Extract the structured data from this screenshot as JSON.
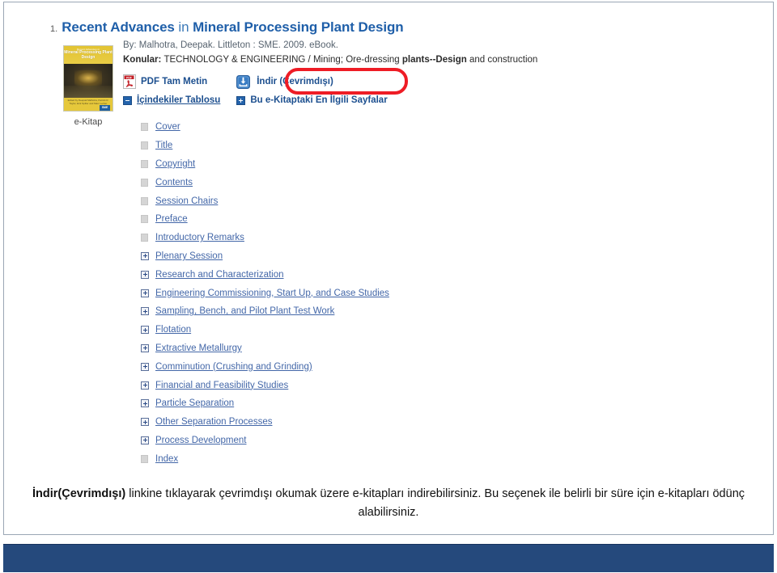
{
  "slide": {
    "footer_color": "#25497c",
    "border_color": "#9aa6b4"
  },
  "result": {
    "number": "1.",
    "title_part1": "Recent Advances",
    "title_connector": "in",
    "title_part2": "Mineral Processing Plant Design",
    "byline": "By: Malhotra, Deepak. Littleton : SME. 2009. eBook.",
    "subjects_label": "Konular:",
    "subjects_text_1": "TECHNOLOGY & ENGINEERING / Mining; Ore-dressing ",
    "subjects_bold": "plants--Design",
    "subjects_text_2": " and construction",
    "cover": {
      "kicker": "Recent Advances in",
      "title": "Mineral Processing Plant Design",
      "authors": "Edited by Deepak Malhotra, Patrick R. Taylor, Erik Spiller and Marc LeVier",
      "badge": "SME",
      "caption": "e-Kitap"
    },
    "actions": {
      "pdf_label": "PDF Tam Metin",
      "download_label": "İndir (Çevrimdışı)",
      "pdf_icon": "pdf-icon",
      "download_icon": "download-icon"
    },
    "toggles": {
      "toc_label": "İçindekiler Tablosu",
      "toc_icon": "minus-box-icon",
      "related_label": "Bu e-Kitaptaki En İlgili Sayfalar",
      "related_icon": "plus-box-icon"
    }
  },
  "toc": {
    "items": [
      {
        "label": "Cover",
        "icon": "leaf-node-icon",
        "expandable": false
      },
      {
        "label": "Title",
        "icon": "leaf-node-icon",
        "expandable": false
      },
      {
        "label": "Copyright",
        "icon": "leaf-node-icon",
        "expandable": false
      },
      {
        "label": "Contents",
        "icon": "leaf-node-icon",
        "expandable": false
      },
      {
        "label": "Session Chairs",
        "icon": "leaf-node-icon",
        "expandable": false
      },
      {
        "label": "Preface",
        "icon": "leaf-node-icon",
        "expandable": false
      },
      {
        "label": "Introductory Remarks",
        "icon": "leaf-node-icon",
        "expandable": false
      },
      {
        "label": "Plenary Session",
        "icon": "plus-box-icon",
        "expandable": true
      },
      {
        "label": "Research and Characterization",
        "icon": "plus-box-icon",
        "expandable": true
      },
      {
        "label": "Engineering Commissioning, Start Up, and Case Studies",
        "icon": "plus-box-icon",
        "expandable": true
      },
      {
        "label": "Sampling, Bench, and Pilot Plant Test Work",
        "icon": "plus-box-icon",
        "expandable": true
      },
      {
        "label": "Flotation",
        "icon": "plus-box-icon",
        "expandable": true
      },
      {
        "label": "Extractive Metallurgy",
        "icon": "plus-box-icon",
        "expandable": true
      },
      {
        "label": "Comminution (Crushing and Grinding)",
        "icon": "plus-box-icon",
        "expandable": true
      },
      {
        "label": "Financial and Feasibility Studies",
        "icon": "plus-box-icon",
        "expandable": true
      },
      {
        "label": "Particle Separation",
        "icon": "plus-box-icon",
        "expandable": true
      },
      {
        "label": "Other Separation Processes",
        "icon": "plus-box-icon",
        "expandable": true
      },
      {
        "label": "Process Development",
        "icon": "plus-box-icon",
        "expandable": true
      },
      {
        "label": "Index",
        "icon": "leaf-node-icon",
        "expandable": false
      }
    ]
  },
  "caption": {
    "bold": "İndir(Çevrimdışı)",
    "rest": " linkine tıklayarak çevrimdışı okumak üzere e-kitapları indirebilirsiniz. Bu seçenek ile belirli bir süre için e-kitapları ödünç alabilirsiniz."
  },
  "annotation": {
    "highlight_color": "#ee1c25",
    "shape": "rounded-rectangle"
  }
}
